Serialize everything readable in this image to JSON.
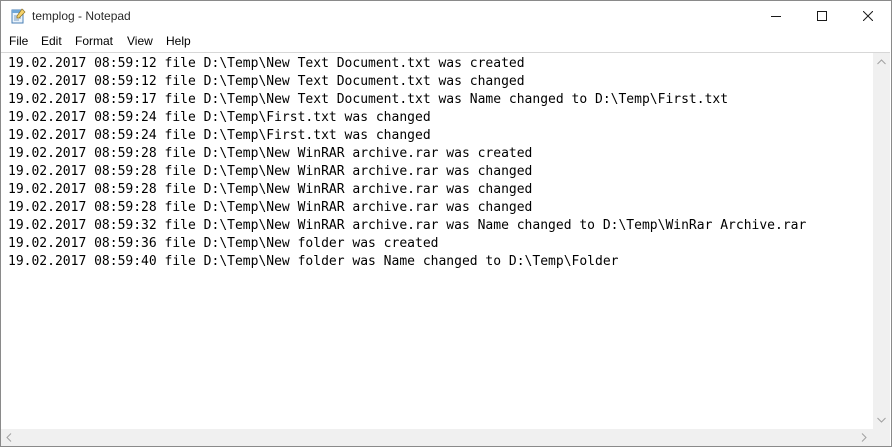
{
  "window": {
    "title": "templog - Notepad"
  },
  "menu": {
    "file": "File",
    "edit": "Edit",
    "format": "Format",
    "view": "View",
    "help": "Help"
  },
  "lines": [
    "19.02.2017 08:59:12 file D:\\Temp\\New Text Document.txt was created",
    "19.02.2017 08:59:12 file D:\\Temp\\New Text Document.txt was changed",
    "19.02.2017 08:59:17 file D:\\Temp\\New Text Document.txt was Name changed to D:\\Temp\\First.txt",
    "19.02.2017 08:59:24 file D:\\Temp\\First.txt was changed",
    "19.02.2017 08:59:24 file D:\\Temp\\First.txt was changed",
    "19.02.2017 08:59:28 file D:\\Temp\\New WinRAR archive.rar was created",
    "19.02.2017 08:59:28 file D:\\Temp\\New WinRAR archive.rar was changed",
    "19.02.2017 08:59:28 file D:\\Temp\\New WinRAR archive.rar was changed",
    "19.02.2017 08:59:28 file D:\\Temp\\New WinRAR archive.rar was changed",
    "19.02.2017 08:59:32 file D:\\Temp\\New WinRAR archive.rar was Name changed to D:\\Temp\\WinRar Archive.rar",
    "19.02.2017 08:59:36 file D:\\Temp\\New folder was created",
    "19.02.2017 08:59:40 file D:\\Temp\\New folder was Name changed to D:\\Temp\\Folder"
  ],
  "icons": {
    "app": "notepad-icon",
    "minimize": "minimize-icon",
    "maximize": "maximize-icon",
    "close": "close-icon"
  },
  "colors": {
    "titlebar": "#ffffff",
    "scrollbar_track": "#f0f0f0",
    "text": "#000000"
  }
}
